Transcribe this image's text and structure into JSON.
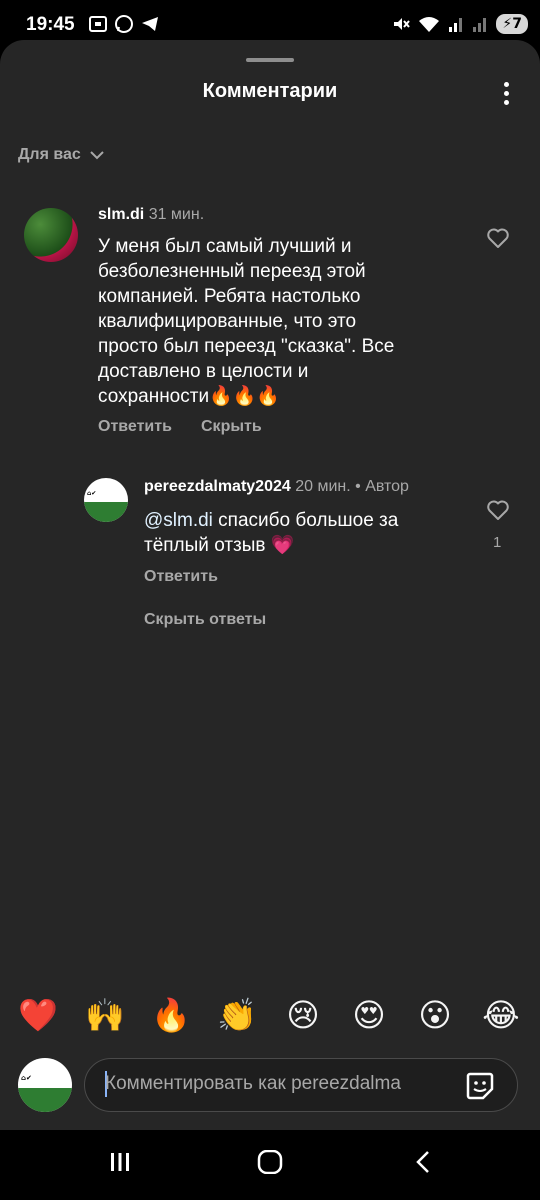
{
  "status_bar": {
    "time": "19:45",
    "battery": "7"
  },
  "sheet": {
    "title": "Комментарии"
  },
  "filter": {
    "label": "Для вас"
  },
  "comment1": {
    "username": "slm.di",
    "time": "31 мин.",
    "text": "У меня был самый лучший и\nбезболезненный  переезд  этой\nкомпанией.  Ребята настолько\nквалифицированные, что это\nпросто был переезд \"сказка\". Все\nдоставлено в целости и\nсохранности🔥🔥🔥",
    "reply_label": "Ответить",
    "hide_label": "Скрыть"
  },
  "reply1": {
    "username": "pereezdalmaty2024",
    "time": "20 мин.",
    "author_badge": "• Автор",
    "mention": "@slm.di",
    "text": " спасибо большое за тёплый отзыв 💗",
    "reply_label": "Ответить",
    "likes": "1"
  },
  "hide_replies_label": "Скрыть ответы",
  "quick_reactions": [
    "❤️",
    "🙌",
    "🔥",
    "👏",
    "😢",
    "😍",
    "😮",
    "😂"
  ],
  "composer": {
    "placeholder": "Комментировать как pereezdalma"
  },
  "icons": {
    "heart": "heart-icon",
    "kebab": "more-options-icon",
    "chevron": "chevron-down-icon",
    "sticker": "sticker-icon"
  },
  "colors": {
    "sheet_bg": "#262626",
    "muted": "#a8a8a8",
    "mention": "#e0f1ff"
  }
}
